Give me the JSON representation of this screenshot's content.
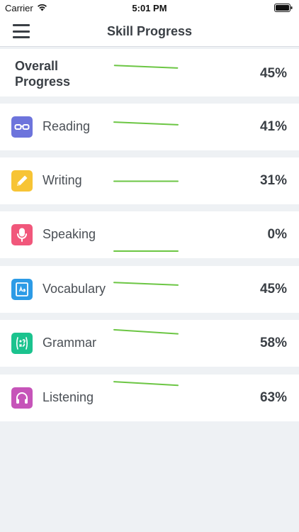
{
  "status_bar": {
    "carrier": "Carrier",
    "time": "5:01 PM"
  },
  "nav": {
    "title": "Skill Progress",
    "menu_icon": "hamburger-icon"
  },
  "accent": "#6cc644",
  "overall": {
    "label": "Overall\nProgress",
    "value": "45%",
    "trend": [
      0.45,
      0.4
    ]
  },
  "skills": [
    {
      "label": "Reading",
      "value": "41%",
      "icon": "glasses-icon",
      "color": "#6d74dc",
      "trend": [
        0.41,
        0.36
      ]
    },
    {
      "label": "Writing",
      "value": "31%",
      "icon": "pencil-icon",
      "color": "#f7c435",
      "trend": [
        0.31,
        0.31
      ]
    },
    {
      "label": "Speaking",
      "value": "0%",
      "icon": "microphone-icon",
      "color": "#f1577b",
      "trend": [
        0.0,
        0.0
      ]
    },
    {
      "label": "Vocabulary",
      "value": "45%",
      "icon": "dictionary-icon",
      "color": "#2c9be6",
      "trend": [
        0.45,
        0.4
      ]
    },
    {
      "label": "Grammar",
      "value": "58%",
      "icon": "grammar-icon",
      "color": "#1bc38e",
      "trend": [
        0.58,
        0.5
      ]
    },
    {
      "label": "Listening",
      "value": "63%",
      "icon": "headphones-icon",
      "color": "#c654b9",
      "trend": [
        0.63,
        0.56
      ]
    }
  ]
}
